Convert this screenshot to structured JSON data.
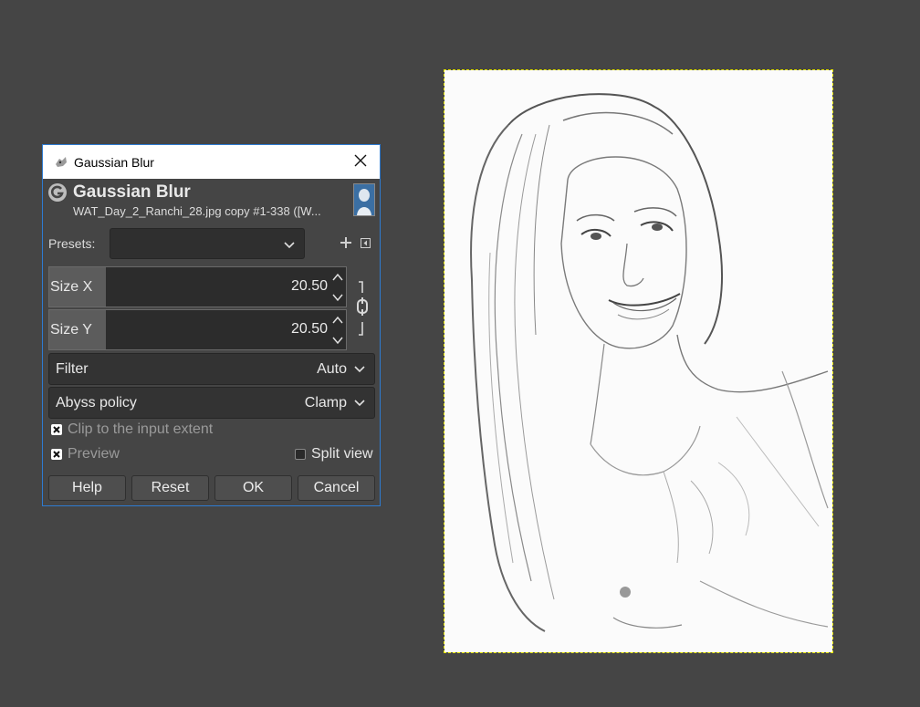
{
  "window": {
    "title": "Gaussian Blur"
  },
  "header": {
    "title": "Gaussian Blur",
    "subtitle": "WAT_Day_2_Ranchi_28.jpg copy #1-338 ([W..."
  },
  "presets": {
    "label": "Presets:",
    "value": ""
  },
  "size_x": {
    "label": "Size X",
    "value": "20.50"
  },
  "size_y": {
    "label": "Size Y",
    "value": "20.50"
  },
  "filter": {
    "label": "Filter",
    "value": "Auto"
  },
  "abyss": {
    "label": "Abyss policy",
    "value": "Clamp"
  },
  "clip": {
    "label": "Clip to the input extent",
    "checked": true
  },
  "preview": {
    "label": "Preview",
    "checked": true
  },
  "split_view": {
    "label": "Split view",
    "checked": false
  },
  "buttons": {
    "help": "Help",
    "reset": "Reset",
    "ok": "OK",
    "cancel": "Cancel"
  },
  "colors": {
    "workspace": "#454545",
    "dialog_border": "#2e7bd1",
    "canvas_outline": "#e6e600"
  }
}
